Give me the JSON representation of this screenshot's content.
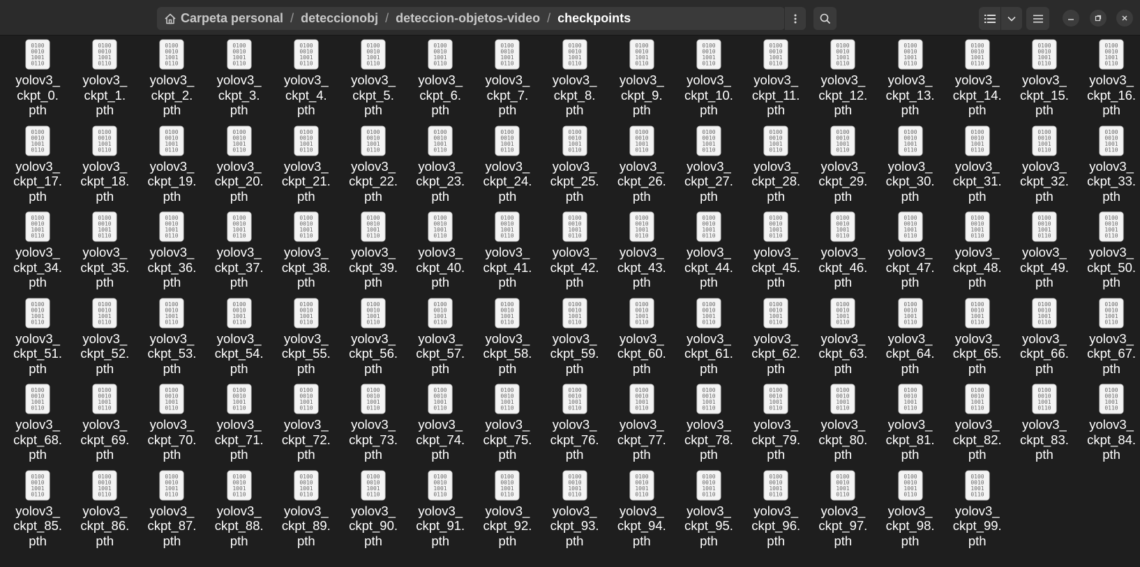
{
  "pathbar": {
    "home_icon": "home-icon",
    "crumbs": [
      "Carpeta personal",
      "deteccionobj",
      "deteccion-objetos-video",
      "checkpoints"
    ],
    "separator": "/"
  },
  "toolbar": {
    "path_menu_icon": "vertical-ellipsis-icon",
    "search_icon": "search-icon",
    "view_icon": "list-view-icon",
    "view_dropdown_icon": "chevron-down-icon",
    "menu_icon": "hamburger-menu-icon"
  },
  "window_controls": {
    "minimize_icon": "minimize-icon",
    "maximize_icon": "maximize-icon",
    "close_icon": "close-icon"
  },
  "files": {
    "icon": "binary-file-icon",
    "icon_text": [
      "0100",
      "0010",
      "1001",
      "0110"
    ],
    "prefix": "yolov3_",
    "label_parts": [
      "yolov3_",
      "ckpt_",
      ".",
      "pth"
    ],
    "count": 100,
    "names": [
      "yolov3_ckpt_0.pth",
      "yolov3_ckpt_1.pth",
      "yolov3_ckpt_2.pth",
      "yolov3_ckpt_3.pth",
      "yolov3_ckpt_4.pth",
      "yolov3_ckpt_5.pth",
      "yolov3_ckpt_6.pth",
      "yolov3_ckpt_7.pth",
      "yolov3_ckpt_8.pth",
      "yolov3_ckpt_9.pth",
      "yolov3_ckpt_10.pth",
      "yolov3_ckpt_11.pth",
      "yolov3_ckpt_12.pth",
      "yolov3_ckpt_13.pth",
      "yolov3_ckpt_14.pth",
      "yolov3_ckpt_15.pth",
      "yolov3_ckpt_16.pth",
      "yolov3_ckpt_17.pth",
      "yolov3_ckpt_18.pth",
      "yolov3_ckpt_19.pth",
      "yolov3_ckpt_20.pth",
      "yolov3_ckpt_21.pth",
      "yolov3_ckpt_22.pth",
      "yolov3_ckpt_23.pth",
      "yolov3_ckpt_24.pth",
      "yolov3_ckpt_25.pth",
      "yolov3_ckpt_26.pth",
      "yolov3_ckpt_27.pth",
      "yolov3_ckpt_28.pth",
      "yolov3_ckpt_29.pth",
      "yolov3_ckpt_30.pth",
      "yolov3_ckpt_31.pth",
      "yolov3_ckpt_32.pth",
      "yolov3_ckpt_33.pth",
      "yolov3_ckpt_34.pth",
      "yolov3_ckpt_35.pth",
      "yolov3_ckpt_36.pth",
      "yolov3_ckpt_37.pth",
      "yolov3_ckpt_38.pth",
      "yolov3_ckpt_39.pth",
      "yolov3_ckpt_40.pth",
      "yolov3_ckpt_41.pth",
      "yolov3_ckpt_42.pth",
      "yolov3_ckpt_43.pth",
      "yolov3_ckpt_44.pth",
      "yolov3_ckpt_45.pth",
      "yolov3_ckpt_46.pth",
      "yolov3_ckpt_47.pth",
      "yolov3_ckpt_48.pth",
      "yolov3_ckpt_49.pth",
      "yolov3_ckpt_50.pth",
      "yolov3_ckpt_51.pth",
      "yolov3_ckpt_52.pth",
      "yolov3_ckpt_53.pth",
      "yolov3_ckpt_54.pth",
      "yolov3_ckpt_55.pth",
      "yolov3_ckpt_56.pth",
      "yolov3_ckpt_57.pth",
      "yolov3_ckpt_58.pth",
      "yolov3_ckpt_59.pth",
      "yolov3_ckpt_60.pth",
      "yolov3_ckpt_61.pth",
      "yolov3_ckpt_62.pth",
      "yolov3_ckpt_63.pth",
      "yolov3_ckpt_64.pth",
      "yolov3_ckpt_65.pth",
      "yolov3_ckpt_66.pth",
      "yolov3_ckpt_67.pth",
      "yolov3_ckpt_68.pth",
      "yolov3_ckpt_69.pth",
      "yolov3_ckpt_70.pth",
      "yolov3_ckpt_71.pth",
      "yolov3_ckpt_72.pth",
      "yolov3_ckpt_73.pth",
      "yolov3_ckpt_74.pth",
      "yolov3_ckpt_75.pth",
      "yolov3_ckpt_76.pth",
      "yolov3_ckpt_77.pth",
      "yolov3_ckpt_78.pth",
      "yolov3_ckpt_79.pth",
      "yolov3_ckpt_80.pth",
      "yolov3_ckpt_81.pth",
      "yolov3_ckpt_82.pth",
      "yolov3_ckpt_83.pth",
      "yolov3_ckpt_84.pth",
      "yolov3_ckpt_85.pth",
      "yolov3_ckpt_86.pth",
      "yolov3_ckpt_87.pth",
      "yolov3_ckpt_88.pth",
      "yolov3_ckpt_89.pth",
      "yolov3_ckpt_90.pth",
      "yolov3_ckpt_91.pth",
      "yolov3_ckpt_92.pth",
      "yolov3_ckpt_93.pth",
      "yolov3_ckpt_94.pth",
      "yolov3_ckpt_95.pth",
      "yolov3_ckpt_96.pth",
      "yolov3_ckpt_97.pth",
      "yolov3_ckpt_98.pth",
      "yolov3_ckpt_99.pth"
    ]
  },
  "colors": {
    "background": "#1e1e1e",
    "header": "#2b2b2b",
    "button": "#3a3a3a",
    "text": "#ffffff",
    "crumb_inactive": "#c9c9c9"
  }
}
